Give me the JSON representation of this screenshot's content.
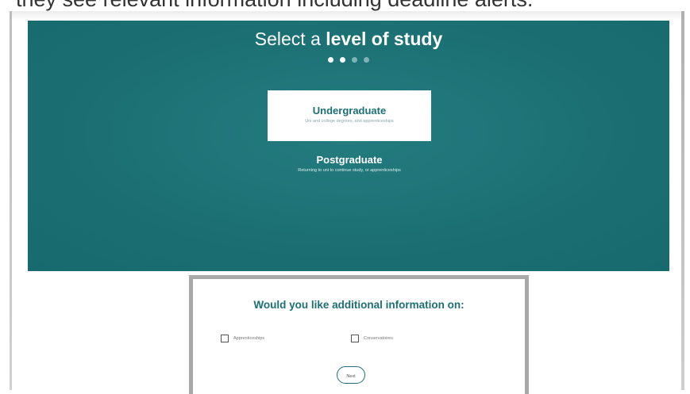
{
  "caption": {
    "text": "they see relevant information including deadline alerts."
  },
  "hero": {
    "title_light": "Select a ",
    "title_bold": "level of study",
    "steps_total": 4,
    "steps_active": 2,
    "background_color": "#1b6f73",
    "options": [
      {
        "title": "Undergraduate",
        "subtitle": "Uni and college degrees, and apprenticeships",
        "selected": true
      },
      {
        "title": "Postgraduate",
        "subtitle": "Returning to uni to continue study, or apprenticeships",
        "selected": false
      }
    ]
  },
  "info": {
    "heading": "Would you like additional information on:",
    "options": [
      {
        "label": "Apprenticeships",
        "checked": false
      },
      {
        "label": "Conservatoires",
        "checked": false
      }
    ],
    "next_label": "Next"
  }
}
